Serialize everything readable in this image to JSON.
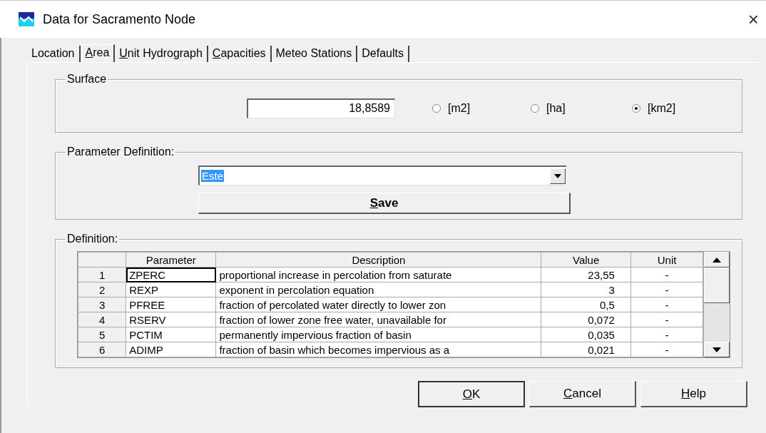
{
  "window": {
    "title": "Data for Sacramento Node",
    "close": "×"
  },
  "tabs": [
    {
      "label": "Location",
      "selected": false,
      "mnemonic": false
    },
    {
      "label": "Area",
      "selected": true,
      "mnemonic": true
    },
    {
      "label": "Unit Hydrograph",
      "selected": false,
      "mnemonic": true
    },
    {
      "label": "Capacities",
      "selected": false,
      "mnemonic": true
    },
    {
      "label": "Meteo Stations",
      "selected": false,
      "mnemonic": false
    },
    {
      "label": "Defaults",
      "selected": false,
      "mnemonic": false
    }
  ],
  "surface": {
    "title": "Surface",
    "value": "18,8589",
    "units": [
      {
        "label": "[m2]",
        "selected": false
      },
      {
        "label": "[ha]",
        "selected": false
      },
      {
        "label": "[km2]",
        "selected": true
      }
    ]
  },
  "parameter_definition": {
    "title": "Parameter Definition:",
    "combo_value": "Este",
    "save_button": {
      "label": "Save",
      "mnemonic": true
    }
  },
  "definition": {
    "title": "Definition:",
    "columns": [
      "Parameter",
      "Description",
      "Value",
      "Unit"
    ],
    "rows": [
      {
        "number": "1",
        "parameter": "ZPERC",
        "description": "proportional increase in percolation from saturate",
        "value": "23,55",
        "unit": "-",
        "focused": true
      },
      {
        "number": "2",
        "parameter": "REXP",
        "description": "exponent in percolation equation",
        "value": "3",
        "unit": "-",
        "focused": false
      },
      {
        "number": "3",
        "parameter": "PFREE",
        "description": "fraction of percolated water directly to lower zon",
        "value": "0,5",
        "unit": "-",
        "focused": false
      },
      {
        "number": "4",
        "parameter": "RSERV",
        "description": "fraction of lower zone free water, unavailable for",
        "value": "0,072",
        "unit": "-",
        "focused": false
      },
      {
        "number": "5",
        "parameter": "PCTIM",
        "description": "permanently impervious fraction of basin",
        "value": "0,035",
        "unit": "-",
        "focused": false
      },
      {
        "number": "6",
        "parameter": "ADIMP",
        "description": "fraction of basin which becomes impervious as a",
        "value": "0,021",
        "unit": "-",
        "focused": false
      }
    ]
  },
  "buttons": [
    {
      "label": "OK",
      "mnemonic": true,
      "default": true
    },
    {
      "label": "Cancel",
      "mnemonic": true,
      "default": false
    },
    {
      "label": "Help",
      "mnemonic": true,
      "default": false
    }
  ]
}
